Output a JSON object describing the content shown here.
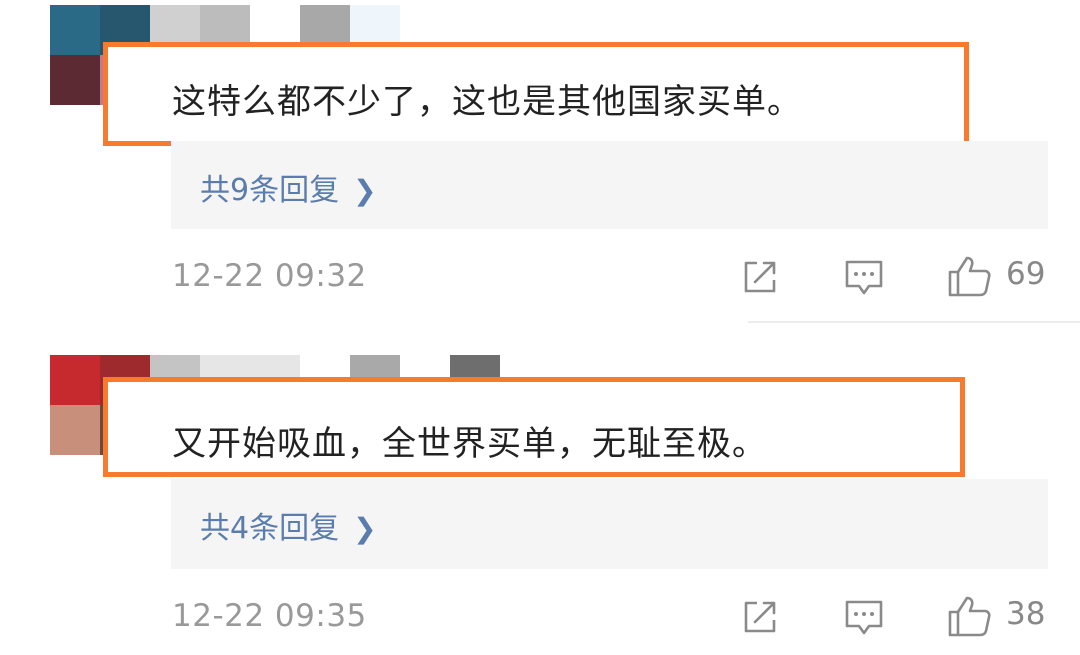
{
  "comments": [
    {
      "text": "这特么都不少了，这也是其他国家买单。",
      "replies_label": "共9条回复",
      "time": "12-22 09:32",
      "likes": "69",
      "avatar_colors": [
        "#2a6a86",
        "#26576e",
        "#5b2a33",
        "#c47a8a"
      ]
    },
    {
      "text": "又开始吸血，全世界买单，无耻至极。",
      "replies_label": "共4条回复",
      "time": "12-22 09:35",
      "likes": "38",
      "avatar_colors": [
        "#c62a2e",
        "#9e2a2e",
        "#c88f7a",
        "#6a4a3a"
      ]
    }
  ],
  "icons": {
    "share": "share-icon",
    "reply": "comment-icon",
    "like": "thumbs-up-icon",
    "chevron": "chevron-right-icon"
  },
  "colors": {
    "highlight_border": "#f77a2e",
    "link": "#5b7dae",
    "meta_text": "#999999"
  }
}
